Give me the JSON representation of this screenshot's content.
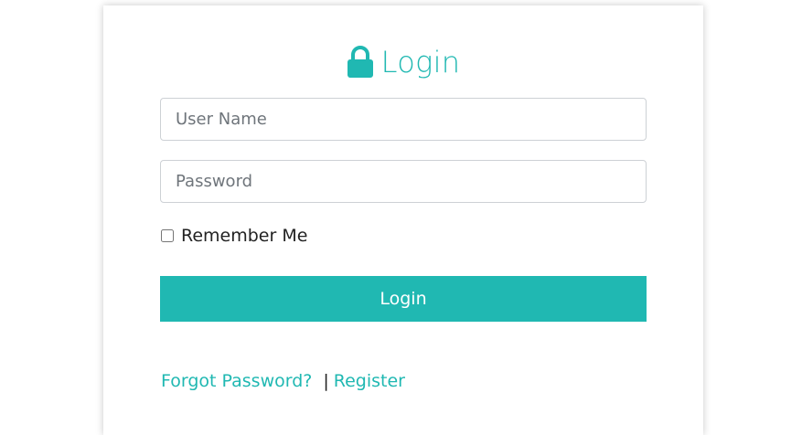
{
  "login_form": {
    "title": "Login",
    "title_icon": "lock-icon",
    "username_placeholder": "User Name",
    "password_placeholder": "Password",
    "username_value": "",
    "password_value": "",
    "remember_label": "Remember Me",
    "remember_checked": false,
    "submit_label": "Login",
    "forgot_link": "Forgot Password?",
    "separator": "|",
    "register_link": "Register"
  },
  "colors": {
    "accent": "#20b8b2",
    "text": "#222222",
    "border": "#cdd1d5"
  }
}
